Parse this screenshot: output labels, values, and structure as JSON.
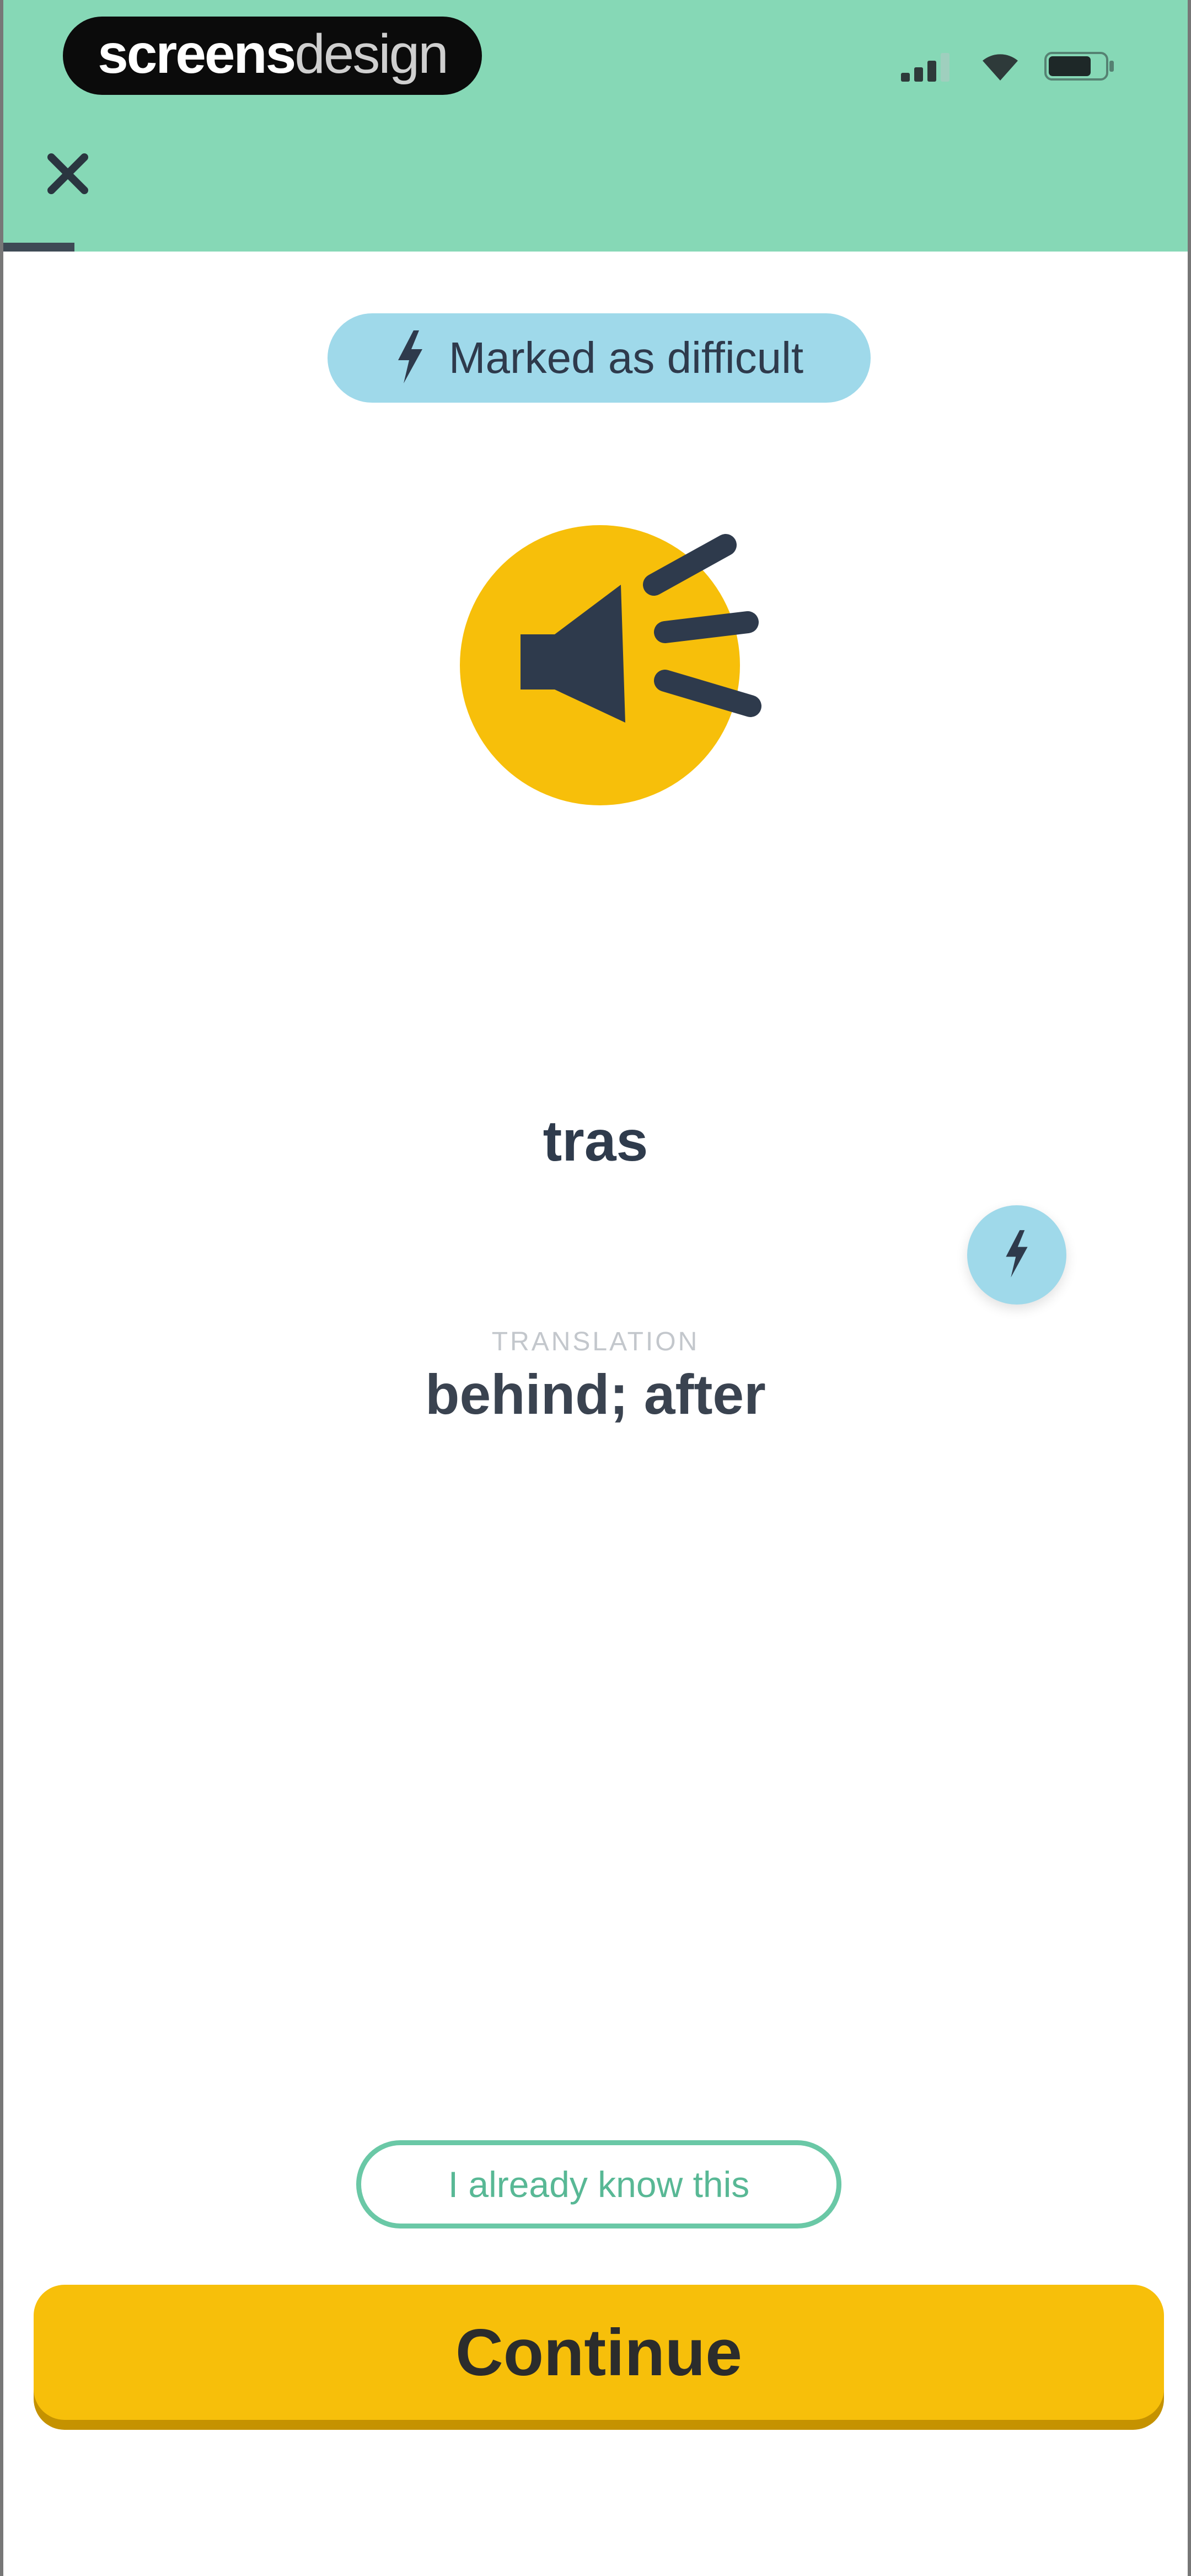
{
  "status_bar": {
    "brand_bold": "screens",
    "brand_light": "design",
    "icons": [
      "signal-icon",
      "wifi-icon",
      "battery-icon"
    ]
  },
  "header": {
    "close_icon": "close-icon",
    "progress_fraction": 0.06
  },
  "badge": {
    "icon": "lightning-icon",
    "label": "Marked as difficult"
  },
  "card": {
    "audio_icon": "speaker-icon",
    "word": "tras",
    "mark_icon": "lightning-icon",
    "translation_label": "TRANSLATION",
    "translation": "behind; after"
  },
  "actions": {
    "already_know": "I already know this",
    "continue": "Continue"
  },
  "colors": {
    "header_bg": "#86d8b6",
    "badge_bg": "#9fd9ea",
    "accent_yellow": "#f7bf0a",
    "text_dark": "#2f3b4c",
    "outline_green": "#6ac8a6"
  }
}
